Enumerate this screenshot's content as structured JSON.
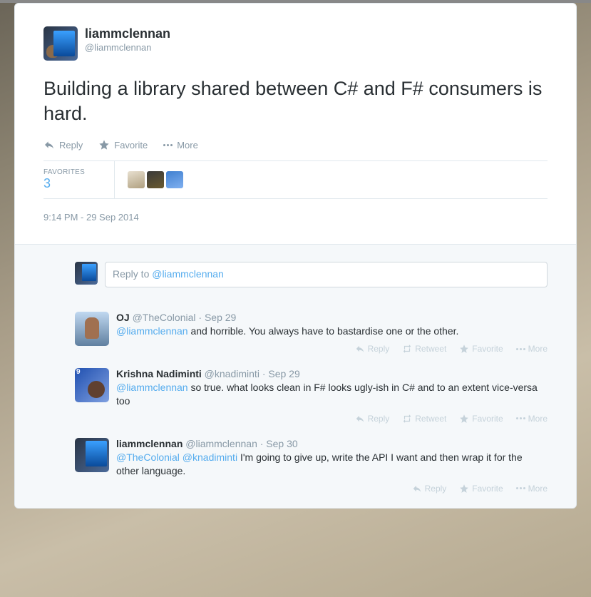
{
  "tweet": {
    "display_name": "liammclennan",
    "handle": "@liammclennan",
    "text": "Building a library shared between C# and F# consumers is hard.",
    "timestamp": "9:14 PM - 29 Sep 2014"
  },
  "actions": {
    "reply": "Reply",
    "favorite": "Favorite",
    "more": "More",
    "retweet": "Retweet"
  },
  "stats": {
    "favorites_label": "FAVORITES",
    "favorites_count": "3"
  },
  "reply_box": {
    "prefix": "Reply to ",
    "mention": "@liammclennan"
  },
  "replies": [
    {
      "name": "OJ",
      "handle": "@TheColonial",
      "date": "Sep 29",
      "mentions": "@liammclennan",
      "text": " and horrible. You always have to bastardise one or the other.",
      "has_retweet": true
    },
    {
      "name": "Krishna Nadiminti",
      "handle": "@knadiminti",
      "date": "Sep 29",
      "mentions": "@liammclennan",
      "text": " so true. what looks clean in F# looks ugly-ish in C# and to an extent vice-versa too",
      "has_retweet": true
    },
    {
      "name": "liammclennan",
      "handle": "@liammclennan",
      "date": "Sep 30",
      "mentions": "@TheColonial @knadiminti",
      "text": " I'm going to give up, write the API I want and then wrap it for the other language.",
      "has_retweet": false
    }
  ]
}
